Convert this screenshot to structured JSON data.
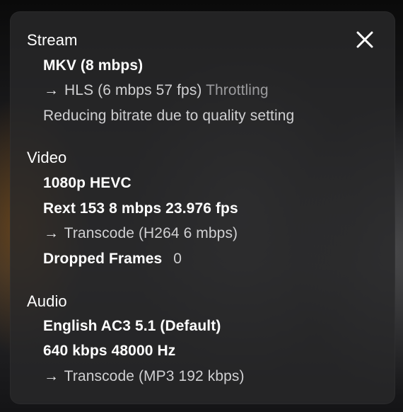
{
  "close_icon": "close-icon",
  "stream": {
    "heading": "Stream",
    "container": "MKV (8 mbps)",
    "arrow": "→",
    "output": "HLS (6 mbps 57 fps)",
    "status": "Throttling",
    "note": "Reducing bitrate due to quality setting"
  },
  "video": {
    "heading": "Video",
    "resolution": "1080p HEVC",
    "profile": "Rext 153 8 mbps 23.976 fps",
    "arrow": "→",
    "transcode": "Transcode (H264 6 mbps)",
    "dropped_label": "Dropped Frames",
    "dropped_value": "0"
  },
  "audio": {
    "heading": "Audio",
    "track": "English AC3 5.1 (Default)",
    "bitrate": "640 kbps 48000 Hz",
    "arrow": "→",
    "transcode": "Transcode (MP3 192 kbps)"
  }
}
